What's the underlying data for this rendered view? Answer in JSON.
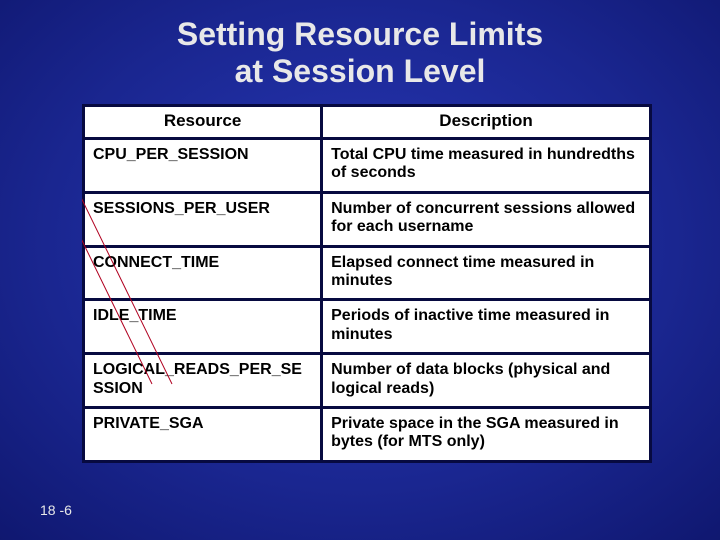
{
  "title_line1": "Setting Resource Limits",
  "title_line2": "at Session Level",
  "headers": {
    "col1": "Resource",
    "col2": "Description"
  },
  "rows": [
    {
      "res": "CPU_PER_SESSION",
      "desc": "Total CPU time measured in hundredths of seconds"
    },
    {
      "res": "SESSIONS_PER_USER",
      "desc": "Number of concurrent sessions allowed for each username"
    },
    {
      "res": "CONNECT_TIME",
      "desc": "Elapsed connect time measured in minutes"
    },
    {
      "res": "IDLE_TIME",
      "desc": "Periods of inactive time measured in minutes"
    },
    {
      "res": "LOGICAL_READS_PER_SESSION",
      "desc": "Number of data blocks (physical and logical reads)"
    },
    {
      "res": "PRIVATE_SGA",
      "desc": "Private space in the SGA measured in bytes (for MTS only)"
    }
  ],
  "page_number": "18 -6"
}
